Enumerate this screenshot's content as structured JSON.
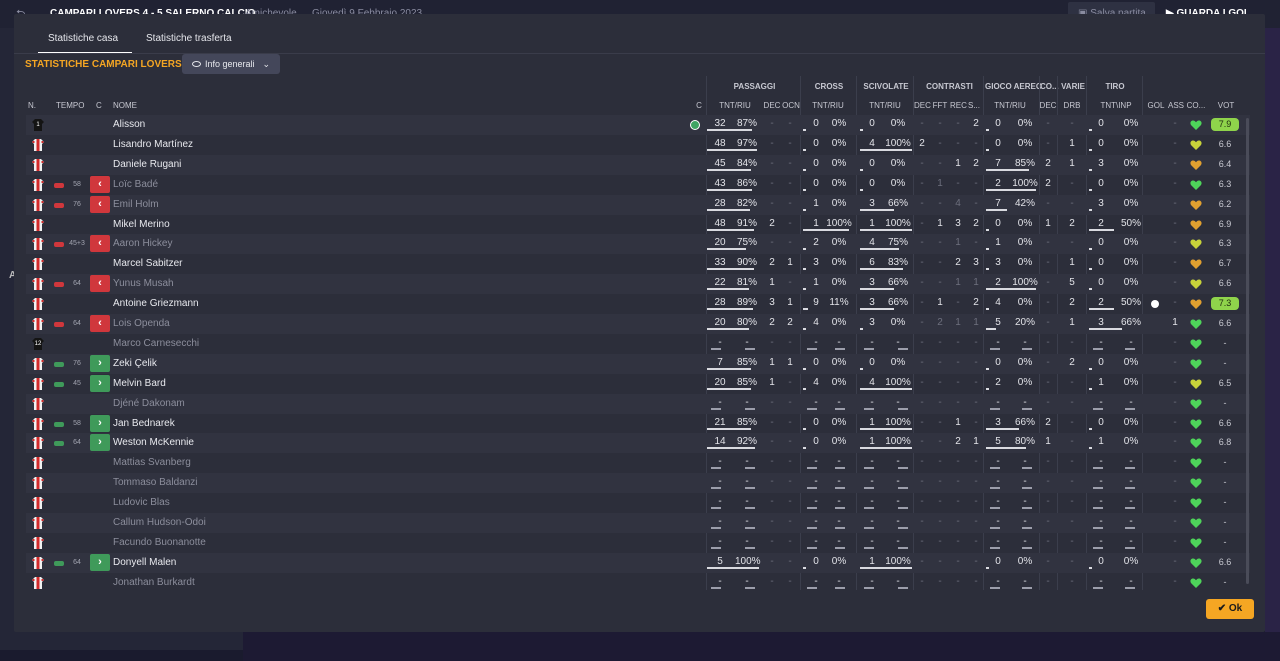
{
  "background": {
    "match_title": "CAMPARI LOVERS  4 - 5  SALERNO CALCIO",
    "match_type": "Amichevole",
    "match_date": "Giovedì 9 Febbraio 2023",
    "save_label": "Salva partita",
    "watch_label": "GUARDA I GOL",
    "left_letter": "A"
  },
  "tabs": [
    {
      "label": "Statistiche casa",
      "active": true
    },
    {
      "label": "Statistiche trasferta",
      "active": false
    }
  ],
  "section_title": "STATISTICHE CAMPARI LOVERS",
  "dropdown_label": "Info generali",
  "groups": [
    "PASSAGGI",
    "CROSS",
    "SCIVOLATE",
    "CONTRASTI",
    "GIOCO AEREO",
    "CO...",
    "VARIE",
    "TIRO"
  ],
  "columns": [
    "N.",
    "TEMPO",
    "C",
    "NOME",
    "C",
    "TNT/RIU",
    "DEC",
    "OCN",
    "TNT/RIU",
    "TNT/RIU",
    "DEC",
    "FFT",
    "REC",
    "S...",
    "TNT/RIU",
    "DEC",
    "DRB",
    "TNT\\INP",
    "GOL",
    "ASS",
    "CO...",
    "VOT"
  ],
  "ok_label": "Ok",
  "colors": {
    "accent": "#f5a623",
    "sub_out": "#d0373c",
    "sub_in": "#3f9a5a",
    "rating_high": "#8fd44b"
  },
  "players": [
    {
      "shirt": "gk",
      "num": "1",
      "name": "Alisson",
      "sub": "",
      "minute": "",
      "captain": true,
      "pass": [
        "32",
        "87%"
      ],
      "pass_dec": "-",
      "pass_ocn": "-",
      "cross": [
        "0",
        "0%"
      ],
      "tackle": [
        "0",
        "0%"
      ],
      "con": [
        "-",
        "-",
        "-",
        "2"
      ],
      "air": [
        "0",
        "0%"
      ],
      "co": "-",
      "drb": "-",
      "shot": [
        "0",
        "0%"
      ],
      "goal": "",
      "ass": "-",
      "heart": "green",
      "vote": "7.9",
      "vote_hi": true,
      "dim": false
    },
    {
      "shirt": "out",
      "num": "",
      "name": "Lisandro Martínez",
      "sub": "",
      "minute": "",
      "pass": [
        "48",
        "97%"
      ],
      "pass_dec": "-",
      "pass_ocn": "-",
      "cross": [
        "0",
        "0%"
      ],
      "tackle": [
        "4",
        "100%"
      ],
      "con": [
        "2",
        "-",
        "-",
        "-"
      ],
      "air": [
        "0",
        "0%"
      ],
      "co": "-",
      "drb": "1",
      "shot": [
        "0",
        "0%"
      ],
      "goal": "",
      "ass": "-",
      "heart": "yellow",
      "vote": "6.6",
      "dim": false
    },
    {
      "shirt": "out",
      "num": "",
      "name": "Daniele Rugani",
      "sub": "",
      "minute": "",
      "pass": [
        "45",
        "84%"
      ],
      "pass_dec": "-",
      "pass_ocn": "-",
      "cross": [
        "0",
        "0%"
      ],
      "tackle": [
        "0",
        "0%"
      ],
      "con": [
        "-",
        "-",
        "1",
        "2"
      ],
      "air": [
        "7",
        "85%"
      ],
      "co": "2",
      "drb": "1",
      "shot": [
        "3",
        "0%"
      ],
      "goal": "",
      "ass": "-",
      "heart": "orange",
      "vote": "6.4",
      "dim": false
    },
    {
      "shirt": "out",
      "num": "",
      "name": "Loïc Badé",
      "sub": "out",
      "minute": "58",
      "pass": [
        "43",
        "86%"
      ],
      "pass_dec": "-",
      "pass_ocn": "-",
      "cross": [
        "0",
        "0%"
      ],
      "tackle": [
        "0",
        "0%"
      ],
      "con": [
        "-",
        "1",
        "-",
        "-"
      ],
      "air": [
        "2",
        "100%"
      ],
      "co": "2",
      "drb": "-",
      "shot": [
        "0",
        "0%"
      ],
      "goal": "",
      "ass": "-",
      "heart": "green",
      "vote": "6.3",
      "dim": true
    },
    {
      "shirt": "out",
      "num": "",
      "name": "Emil Holm",
      "sub": "out",
      "minute": "76",
      "pass": [
        "28",
        "82%"
      ],
      "pass_dec": "-",
      "pass_ocn": "-",
      "cross": [
        "1",
        "0%"
      ],
      "tackle": [
        "3",
        "66%"
      ],
      "con": [
        "-",
        "-",
        "4",
        "-"
      ],
      "air": [
        "7",
        "42%"
      ],
      "co": "-",
      "drb": "-",
      "shot": [
        "3",
        "0%"
      ],
      "goal": "",
      "ass": "-",
      "heart": "orange",
      "vote": "6.2",
      "dim": true
    },
    {
      "shirt": "out",
      "num": "",
      "name": "Mikel Merino",
      "sub": "",
      "minute": "",
      "pass": [
        "48",
        "91%"
      ],
      "pass_dec": "2",
      "pass_ocn": "-",
      "cross": [
        "1",
        "100%"
      ],
      "tackle": [
        "1",
        "100%"
      ],
      "con": [
        "-",
        "1",
        "3",
        "2"
      ],
      "air": [
        "0",
        "0%"
      ],
      "co": "1",
      "drb": "2",
      "shot": [
        "2",
        "50%"
      ],
      "goal": "",
      "ass": "-",
      "heart": "orange",
      "vote": "6.9",
      "dim": false
    },
    {
      "shirt": "out",
      "num": "",
      "name": "Aaron Hickey",
      "sub": "out",
      "minute": "45+3",
      "pass": [
        "20",
        "75%"
      ],
      "pass_dec": "-",
      "pass_ocn": "-",
      "cross": [
        "2",
        "0%"
      ],
      "tackle": [
        "4",
        "75%"
      ],
      "con": [
        "-",
        "-",
        "1",
        "-"
      ],
      "air": [
        "1",
        "0%"
      ],
      "co": "-",
      "drb": "-",
      "shot": [
        "0",
        "0%"
      ],
      "goal": "",
      "ass": "-",
      "heart": "yellow",
      "vote": "6.3",
      "dim": true
    },
    {
      "shirt": "out",
      "num": "",
      "name": "Marcel Sabitzer",
      "sub": "",
      "minute": "",
      "pass": [
        "33",
        "90%"
      ],
      "pass_dec": "2",
      "pass_ocn": "1",
      "cross": [
        "3",
        "0%"
      ],
      "tackle": [
        "6",
        "83%"
      ],
      "con": [
        "-",
        "-",
        "2",
        "3"
      ],
      "air": [
        "3",
        "0%"
      ],
      "co": "-",
      "drb": "1",
      "shot": [
        "0",
        "0%"
      ],
      "goal": "",
      "ass": "-",
      "heart": "orange",
      "vote": "6.7",
      "dim": false
    },
    {
      "shirt": "out",
      "num": "",
      "name": "Yunus Musah",
      "sub": "out",
      "minute": "64",
      "pass": [
        "22",
        "81%"
      ],
      "pass_dec": "1",
      "pass_ocn": "-",
      "cross": [
        "1",
        "0%"
      ],
      "tackle": [
        "3",
        "66%"
      ],
      "con": [
        "-",
        "-",
        "1",
        "1"
      ],
      "air": [
        "2",
        "100%"
      ],
      "co": "-",
      "drb": "5",
      "shot": [
        "0",
        "0%"
      ],
      "goal": "",
      "ass": "-",
      "heart": "yellow",
      "vote": "6.6",
      "dim": true
    },
    {
      "shirt": "out",
      "num": "",
      "name": "Antoine Griezmann",
      "sub": "",
      "minute": "",
      "pass": [
        "28",
        "89%"
      ],
      "pass_dec": "3",
      "pass_ocn": "1",
      "cross": [
        "9",
        "11%"
      ],
      "tackle": [
        "3",
        "66%"
      ],
      "con": [
        "-",
        "1",
        "-",
        "2"
      ],
      "air": [
        "4",
        "0%"
      ],
      "co": "-",
      "drb": "2",
      "shot": [
        "2",
        "50%"
      ],
      "goal": "ball",
      "ass": "-",
      "heart": "orange",
      "vote": "7.3",
      "vote_hi": true,
      "dim": false
    },
    {
      "shirt": "out",
      "num": "",
      "name": "Lois Openda",
      "sub": "out",
      "minute": "64",
      "pass": [
        "20",
        "80%"
      ],
      "pass_dec": "2",
      "pass_ocn": "2",
      "cross": [
        "4",
        "0%"
      ],
      "tackle": [
        "3",
        "0%"
      ],
      "con": [
        "-",
        "2",
        "1",
        "1"
      ],
      "air": [
        "5",
        "20%"
      ],
      "co": "-",
      "drb": "1",
      "shot": [
        "3",
        "66%"
      ],
      "goal": "",
      "ass": "1",
      "heart": "green",
      "vote": "6.6",
      "dim": true
    },
    {
      "shirt": "gk",
      "num": "12",
      "name": "Marco Carnesecchi",
      "sub": "",
      "minute": "",
      "pass": [
        "-",
        "-"
      ],
      "pass_dec": "-",
      "pass_ocn": "-",
      "cross": [
        "-",
        "-"
      ],
      "tackle": [
        "-",
        "-"
      ],
      "con": [
        "-",
        "-",
        "-",
        "-"
      ],
      "air": [
        "-",
        "-"
      ],
      "co": "-",
      "drb": "-",
      "shot": [
        "-",
        "-"
      ],
      "goal": "",
      "ass": "-",
      "heart": "green",
      "vote": "-",
      "dim": true,
      "empty": true
    },
    {
      "shirt": "out",
      "num": "",
      "name": "Zeki Çelik",
      "sub": "in",
      "minute": "76",
      "pass": [
        "7",
        "85%"
      ],
      "pass_dec": "1",
      "pass_ocn": "1",
      "cross": [
        "0",
        "0%"
      ],
      "tackle": [
        "0",
        "0%"
      ],
      "con": [
        "-",
        "-",
        "-",
        "-"
      ],
      "air": [
        "0",
        "0%"
      ],
      "co": "-",
      "drb": "2",
      "shot": [
        "0",
        "0%"
      ],
      "goal": "",
      "ass": "-",
      "heart": "green",
      "vote": "-",
      "dim": false
    },
    {
      "shirt": "out",
      "num": "",
      "name": "Melvin Bard",
      "sub": "in",
      "minute": "45",
      "pass": [
        "20",
        "85%"
      ],
      "pass_dec": "1",
      "pass_ocn": "-",
      "cross": [
        "4",
        "0%"
      ],
      "tackle": [
        "4",
        "100%"
      ],
      "con": [
        "-",
        "-",
        "-",
        "-"
      ],
      "air": [
        "2",
        "0%"
      ],
      "co": "-",
      "drb": "-",
      "shot": [
        "1",
        "0%"
      ],
      "goal": "",
      "ass": "-",
      "heart": "yellow",
      "vote": "6.5",
      "dim": false
    },
    {
      "shirt": "out",
      "num": "",
      "name": "Djéné Dakonam",
      "sub": "",
      "minute": "",
      "pass": [
        "-",
        "-"
      ],
      "pass_dec": "-",
      "pass_ocn": "-",
      "cross": [
        "-",
        "-"
      ],
      "tackle": [
        "-",
        "-"
      ],
      "con": [
        "-",
        "-",
        "-",
        "-"
      ],
      "air": [
        "-",
        "-"
      ],
      "co": "-",
      "drb": "-",
      "shot": [
        "-",
        "-"
      ],
      "goal": "",
      "ass": "-",
      "heart": "green",
      "vote": "-",
      "dim": true,
      "empty": true
    },
    {
      "shirt": "out",
      "num": "",
      "name": "Jan Bednarek",
      "sub": "in",
      "minute": "58",
      "pass": [
        "21",
        "85%"
      ],
      "pass_dec": "-",
      "pass_ocn": "-",
      "cross": [
        "0",
        "0%"
      ],
      "tackle": [
        "1",
        "100%"
      ],
      "con": [
        "-",
        "-",
        "1",
        "-"
      ],
      "air": [
        "3",
        "66%"
      ],
      "co": "2",
      "drb": "-",
      "shot": [
        "0",
        "0%"
      ],
      "goal": "",
      "ass": "-",
      "heart": "green",
      "vote": "6.6",
      "dim": false
    },
    {
      "shirt": "out",
      "num": "",
      "name": "Weston McKennie",
      "sub": "in",
      "minute": "64",
      "pass": [
        "14",
        "92%"
      ],
      "pass_dec": "-",
      "pass_ocn": "-",
      "cross": [
        "0",
        "0%"
      ],
      "tackle": [
        "1",
        "100%"
      ],
      "con": [
        "-",
        "-",
        "2",
        "1"
      ],
      "air": [
        "5",
        "80%"
      ],
      "co": "1",
      "drb": "-",
      "shot": [
        "1",
        "0%"
      ],
      "goal": "",
      "ass": "-",
      "heart": "green",
      "vote": "6.8",
      "dim": false
    },
    {
      "shirt": "out",
      "num": "",
      "name": "Mattias Svanberg",
      "sub": "",
      "minute": "",
      "pass": [
        "-",
        "-"
      ],
      "pass_dec": "-",
      "pass_ocn": "-",
      "cross": [
        "-",
        "-"
      ],
      "tackle": [
        "-",
        "-"
      ],
      "con": [
        "-",
        "-",
        "-",
        "-"
      ],
      "air": [
        "-",
        "-"
      ],
      "co": "-",
      "drb": "-",
      "shot": [
        "-",
        "-"
      ],
      "goal": "",
      "ass": "-",
      "heart": "green",
      "vote": "-",
      "dim": true,
      "empty": true
    },
    {
      "shirt": "out",
      "num": "",
      "name": "Tommaso Baldanzi",
      "sub": "",
      "minute": "",
      "pass": [
        "-",
        "-"
      ],
      "pass_dec": "-",
      "pass_ocn": "-",
      "cross": [
        "-",
        "-"
      ],
      "tackle": [
        "-",
        "-"
      ],
      "con": [
        "-",
        "-",
        "-",
        "-"
      ],
      "air": [
        "-",
        "-"
      ],
      "co": "-",
      "drb": "-",
      "shot": [
        "-",
        "-"
      ],
      "goal": "",
      "ass": "-",
      "heart": "green",
      "vote": "-",
      "dim": true,
      "empty": true
    },
    {
      "shirt": "out",
      "num": "",
      "name": "Ludovic Blas",
      "sub": "",
      "minute": "",
      "pass": [
        "-",
        "-"
      ],
      "pass_dec": "-",
      "pass_ocn": "-",
      "cross": [
        "-",
        "-"
      ],
      "tackle": [
        "-",
        "-"
      ],
      "con": [
        "-",
        "-",
        "-",
        "-"
      ],
      "air": [
        "-",
        "-"
      ],
      "co": "-",
      "drb": "-",
      "shot": [
        "-",
        "-"
      ],
      "goal": "",
      "ass": "-",
      "heart": "green",
      "vote": "-",
      "dim": true,
      "empty": true
    },
    {
      "shirt": "out",
      "num": "",
      "name": "Callum Hudson-Odoi",
      "sub": "",
      "minute": "",
      "pass": [
        "-",
        "-"
      ],
      "pass_dec": "-",
      "pass_ocn": "-",
      "cross": [
        "-",
        "-"
      ],
      "tackle": [
        "-",
        "-"
      ],
      "con": [
        "-",
        "-",
        "-",
        "-"
      ],
      "air": [
        "-",
        "-"
      ],
      "co": "-",
      "drb": "-",
      "shot": [
        "-",
        "-"
      ],
      "goal": "",
      "ass": "-",
      "heart": "green",
      "vote": "-",
      "dim": true,
      "empty": true
    },
    {
      "shirt": "out",
      "num": "",
      "name": "Facundo Buonanotte",
      "sub": "",
      "minute": "",
      "pass": [
        "-",
        "-"
      ],
      "pass_dec": "-",
      "pass_ocn": "-",
      "cross": [
        "-",
        "-"
      ],
      "tackle": [
        "-",
        "-"
      ],
      "con": [
        "-",
        "-",
        "-",
        "-"
      ],
      "air": [
        "-",
        "-"
      ],
      "co": "-",
      "drb": "-",
      "shot": [
        "-",
        "-"
      ],
      "goal": "",
      "ass": "-",
      "heart": "green",
      "vote": "-",
      "dim": true,
      "empty": true
    },
    {
      "shirt": "out",
      "num": "",
      "name": "Donyell Malen",
      "sub": "in",
      "minute": "64",
      "pass": [
        "5",
        "100%"
      ],
      "pass_dec": "-",
      "pass_ocn": "-",
      "cross": [
        "0",
        "0%"
      ],
      "tackle": [
        "1",
        "100%"
      ],
      "con": [
        "-",
        "-",
        "-",
        "-"
      ],
      "air": [
        "0",
        "0%"
      ],
      "co": "-",
      "drb": "-",
      "shot": [
        "0",
        "0%"
      ],
      "goal": "",
      "ass": "-",
      "heart": "green",
      "vote": "6.6",
      "dim": false
    },
    {
      "shirt": "out",
      "num": "",
      "name": "Jonathan Burkardt",
      "sub": "",
      "minute": "",
      "pass": [
        "-",
        "-"
      ],
      "pass_dec": "-",
      "pass_ocn": "-",
      "cross": [
        "-",
        "-"
      ],
      "tackle": [
        "-",
        "-"
      ],
      "con": [
        "-",
        "-",
        "-",
        "-"
      ],
      "air": [
        "-",
        "-"
      ],
      "co": "-",
      "drb": "-",
      "shot": [
        "-",
        "-"
      ],
      "goal": "",
      "ass": "-",
      "heart": "green",
      "vote": "-",
      "dim": true,
      "empty": true
    }
  ]
}
